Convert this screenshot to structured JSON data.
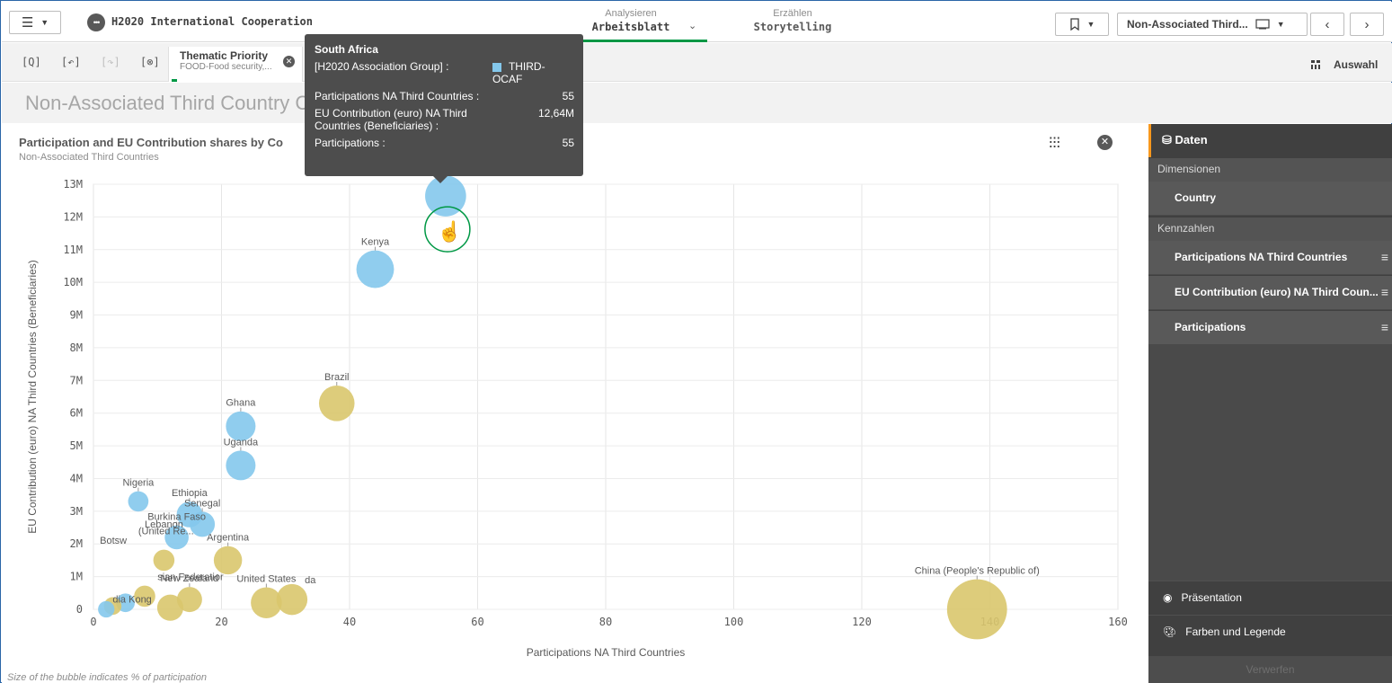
{
  "topbar": {
    "app_title": "H2020 International Cooperation",
    "mode_analyse_top": "Analysieren",
    "mode_analyse_bottom": "Arbeitsblatt",
    "mode_tell_top": "Erzählen",
    "mode_tell_bottom": "Storytelling",
    "sheet_name": "Non-Associated Third..."
  },
  "selection": {
    "field": "Thematic Priority",
    "value": "FOOD-Food security,...",
    "selections_label": "Auswahl"
  },
  "sheet_title": "Non-Associated Third Country Cooperation",
  "chart": {
    "title": "Participation and EU Contribution shares by Co",
    "subtitle": "Non-Associated Third Countries",
    "footnote": "Size of the bubble indicates % of participation"
  },
  "tooltip": {
    "country": "South Africa",
    "group_label": "[H2020 Association Group] :",
    "group_value": "THIRD-OCAF",
    "m1_label": "Participations NA Third Countries :",
    "m1_value": "55",
    "m2_label": "EU Contribution (euro) NA Third Countries (Beneficiaries) :",
    "m2_value": "12,64M",
    "m3_label": "Participations :",
    "m3_value": "55"
  },
  "panel": {
    "header": "Daten",
    "dimensions_label": "Dimensionen",
    "dimension": "Country",
    "measures_label": "Kennzahlen",
    "measures": [
      "Participations NA Third Countries",
      "EU Contribution (euro) NA Third Coun...",
      "Participations"
    ],
    "presentation": "Präsentation",
    "colors": "Farben und Legende",
    "discard": "Verwerfen"
  },
  "chart_data": {
    "type": "scatter",
    "xlabel": "Participations NA Third Countries",
    "ylabel": "EU Contribution (euro) NA Third Countries (Beneficiaries)",
    "xlim": [
      0,
      160
    ],
    "ylim": [
      0,
      13000000
    ],
    "x_ticks": [
      "0",
      "20",
      "40",
      "60",
      "80",
      "100",
      "120",
      "140",
      "160"
    ],
    "y_ticks": [
      "0",
      "1M",
      "2M",
      "3M",
      "4M",
      "5M",
      "6M",
      "7M",
      "8M",
      "9M",
      "10M",
      "11M",
      "12M",
      "13M"
    ],
    "colors": {
      "THIRD-OCAF": "#84c8ec",
      "other": "#d9c66d"
    },
    "points": [
      {
        "label": "",
        "x": 55,
        "y": 12640000,
        "group": "THIRD-OCAF",
        "size": 55
      },
      {
        "label": "Kenya",
        "x": 44,
        "y": 10400000,
        "group": "THIRD-OCAF",
        "size": 44
      },
      {
        "label": "Brazil",
        "x": 38,
        "y": 6300000,
        "group": "other",
        "size": 38
      },
      {
        "label": "Ghana",
        "x": 23,
        "y": 5600000,
        "group": "THIRD-OCAF",
        "size": 23
      },
      {
        "label": "Uganda",
        "x": 23,
        "y": 4400000,
        "group": "THIRD-OCAF",
        "size": 23
      },
      {
        "label": "Nigeria",
        "x": 7,
        "y": 3300000,
        "group": "THIRD-OCAF",
        "size": 7
      },
      {
        "label": "Ethiopia",
        "x": 15,
        "y": 2900000,
        "group": "THIRD-OCAF",
        "size": 15
      },
      {
        "label": "Senegal",
        "x": 17,
        "y": 2600000,
        "group": "THIRD-OCAF",
        "size": 14
      },
      {
        "label": "Burkina Faso",
        "x": 13,
        "y": 2200000,
        "group": "THIRD-OCAF",
        "size": 12
      },
      {
        "label": "Argentina",
        "x": 21,
        "y": 1500000,
        "group": "other",
        "size": 20
      },
      {
        "label": "United States",
        "x": 27,
        "y": 200000,
        "group": "other",
        "size": 26
      },
      {
        "label": "",
        "x": 31,
        "y": 300000,
        "group": "other",
        "size": 26
      },
      {
        "label": "New Zealand",
        "x": 15,
        "y": 300000,
        "group": "other",
        "size": 14
      },
      {
        "label": "",
        "x": 12,
        "y": 50000,
        "group": "other",
        "size": 16
      },
      {
        "label": "China (People's Republic of)",
        "x": 138,
        "y": 0,
        "group": "other",
        "size": 140
      },
      {
        "label": "",
        "x": 11,
        "y": 1500000,
        "group": "other",
        "size": 8
      },
      {
        "label": "",
        "x": 8,
        "y": 400000,
        "group": "other",
        "size": 8
      },
      {
        "label": "",
        "x": 5,
        "y": 200000,
        "group": "THIRD-OCAF",
        "size": 5
      },
      {
        "label": "",
        "x": 3,
        "y": 100000,
        "group": "other",
        "size": 4
      },
      {
        "label": "",
        "x": 2,
        "y": 0,
        "group": "THIRD-OCAF",
        "size": 3
      }
    ],
    "crowded_labels": [
      {
        "text": "Lebanon",
        "x": 8,
        "y": 2500000
      },
      {
        "text": "Botsw",
        "x": 1,
        "y": 2000000
      },
      {
        "text": "(United Re...",
        "x": 7,
        "y": 2300000
      },
      {
        "text": "sian Federatior",
        "x": 10,
        "y": 900000
      },
      {
        "text": "dia Kong",
        "x": 3,
        "y": 200000
      },
      {
        "text": "da",
        "x": 33,
        "y": 800000
      }
    ]
  }
}
